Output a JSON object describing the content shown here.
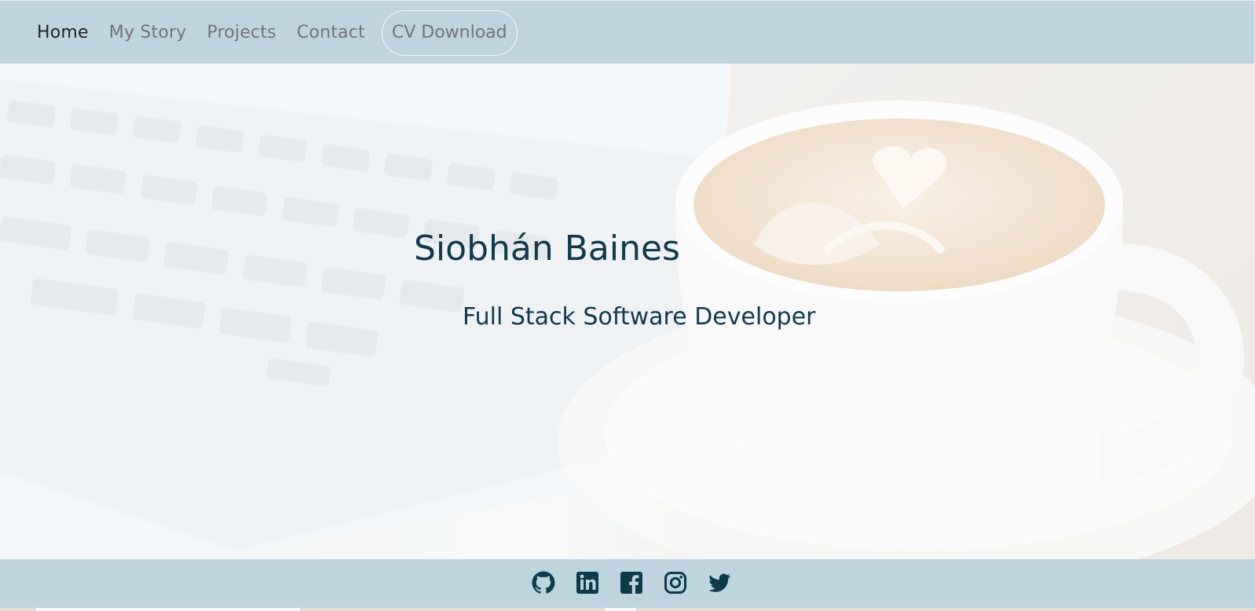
{
  "nav": {
    "items": [
      {
        "label": "Home",
        "active": true
      },
      {
        "label": "My Story",
        "active": false
      },
      {
        "label": "Projects",
        "active": false
      },
      {
        "label": "Contact",
        "active": false
      }
    ],
    "cv_label": "CV Download"
  },
  "hero": {
    "title": "Siobhán Baines",
    "subtitle": "Full Stack Software Developer",
    "background": "laptop-and-latte-photo"
  },
  "footer": {
    "social_icons": [
      "github-icon",
      "linkedin-icon",
      "facebook-icon",
      "instagram-icon",
      "twitter-icon"
    ]
  },
  "colors": {
    "nav_bg": "#bed5e0",
    "footer_bg": "#bed5e0",
    "heading_text": "#0f3a4c",
    "nav_text": "#6f7478",
    "nav_active_text": "#1d2226",
    "icon_color": "#0e3a4b"
  }
}
